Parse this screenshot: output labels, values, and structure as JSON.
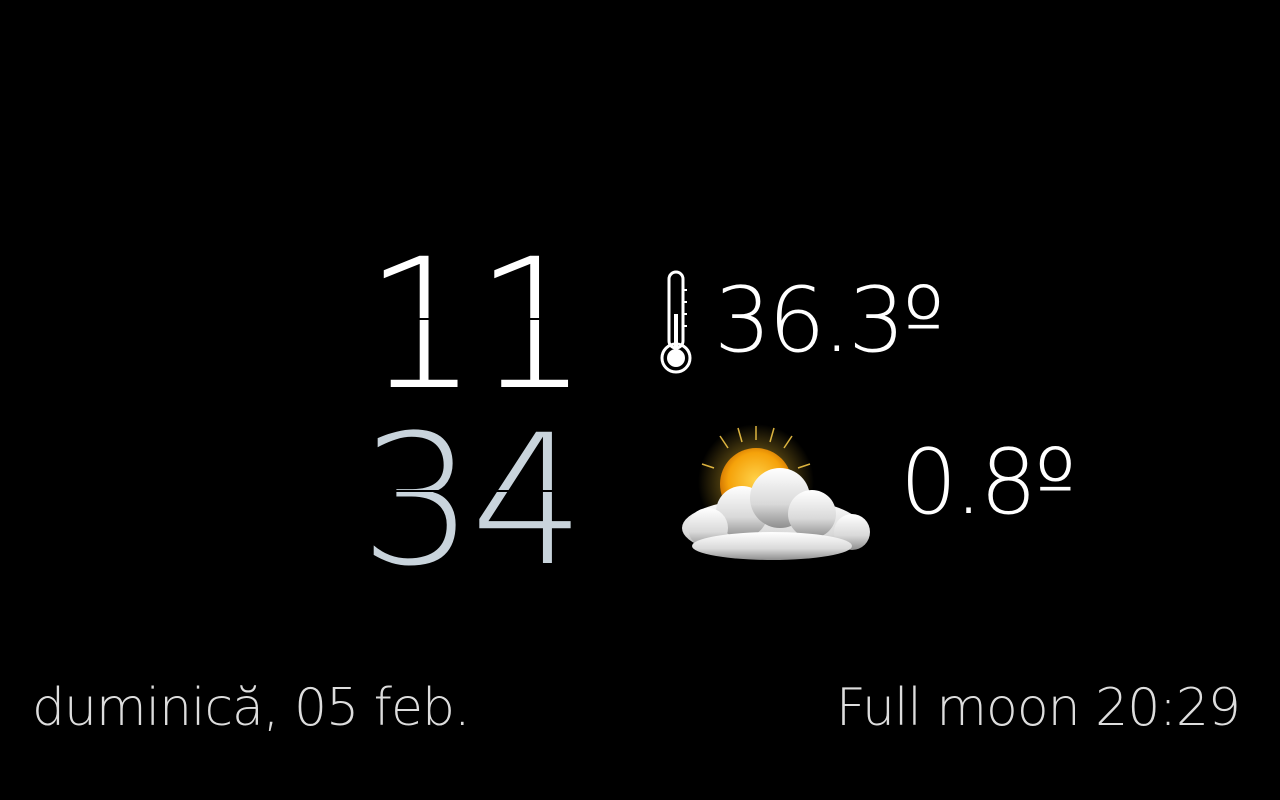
{
  "clock": {
    "hours": "11",
    "minutes": "34",
    "hours_color": "#ffffff",
    "minutes_color": "#c9d4dc"
  },
  "weather": {
    "indoor_temp": "36.3º",
    "indoor_icon": "thermometer-icon",
    "outdoor_temp": "0.8º",
    "outdoor_icon": "partly-cloudy-icon"
  },
  "footer": {
    "date": "duminică, 05 feb.",
    "moon": "Full moon 20:29"
  }
}
